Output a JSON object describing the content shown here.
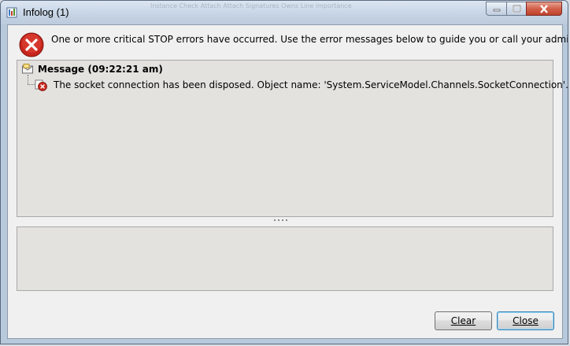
{
  "window": {
    "title": "Infolog (1)",
    "background_text": "Instance     Check     Attach   Attach  Signatures              Owns       Line importance"
  },
  "summary": "One or more critical STOP errors have occurred. Use the error messages below to guide you or call your administrator.",
  "tree": {
    "header": "Message (09:22:21 am)",
    "message": "The socket connection has been disposed. Object name: 'System.ServiceModel.Channels.SocketConnection'."
  },
  "buttons": {
    "clear": "Clear",
    "close": "Close"
  },
  "icons": {
    "app": "infolog-icon",
    "error": "critical-stop-icon",
    "message": "message-envelope-icon",
    "stop_small": "stop-small-icon"
  },
  "colors": {
    "error_red": "#d0342c",
    "panel": "#e4e2df",
    "client": "#f0f0f0"
  }
}
